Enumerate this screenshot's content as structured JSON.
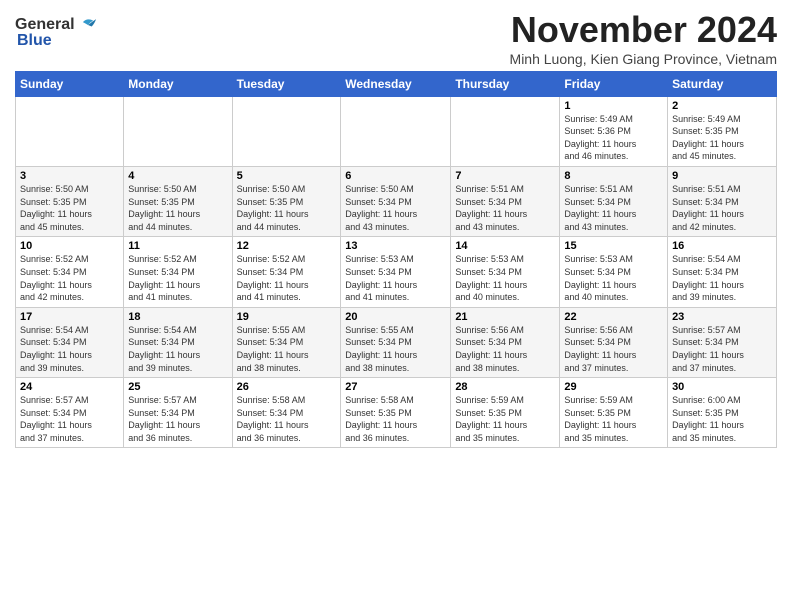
{
  "header": {
    "logo_general": "General",
    "logo_blue": "Blue",
    "month_title": "November 2024",
    "location": "Minh Luong, Kien Giang Province, Vietnam"
  },
  "weekdays": [
    "Sunday",
    "Monday",
    "Tuesday",
    "Wednesday",
    "Thursday",
    "Friday",
    "Saturday"
  ],
  "weeks": [
    [
      {
        "day": "",
        "info": ""
      },
      {
        "day": "",
        "info": ""
      },
      {
        "day": "",
        "info": ""
      },
      {
        "day": "",
        "info": ""
      },
      {
        "day": "",
        "info": ""
      },
      {
        "day": "1",
        "info": "Sunrise: 5:49 AM\nSunset: 5:36 PM\nDaylight: 11 hours\nand 46 minutes."
      },
      {
        "day": "2",
        "info": "Sunrise: 5:49 AM\nSunset: 5:35 PM\nDaylight: 11 hours\nand 45 minutes."
      }
    ],
    [
      {
        "day": "3",
        "info": "Sunrise: 5:50 AM\nSunset: 5:35 PM\nDaylight: 11 hours\nand 45 minutes."
      },
      {
        "day": "4",
        "info": "Sunrise: 5:50 AM\nSunset: 5:35 PM\nDaylight: 11 hours\nand 44 minutes."
      },
      {
        "day": "5",
        "info": "Sunrise: 5:50 AM\nSunset: 5:35 PM\nDaylight: 11 hours\nand 44 minutes."
      },
      {
        "day": "6",
        "info": "Sunrise: 5:50 AM\nSunset: 5:34 PM\nDaylight: 11 hours\nand 43 minutes."
      },
      {
        "day": "7",
        "info": "Sunrise: 5:51 AM\nSunset: 5:34 PM\nDaylight: 11 hours\nand 43 minutes."
      },
      {
        "day": "8",
        "info": "Sunrise: 5:51 AM\nSunset: 5:34 PM\nDaylight: 11 hours\nand 43 minutes."
      },
      {
        "day": "9",
        "info": "Sunrise: 5:51 AM\nSunset: 5:34 PM\nDaylight: 11 hours\nand 42 minutes."
      }
    ],
    [
      {
        "day": "10",
        "info": "Sunrise: 5:52 AM\nSunset: 5:34 PM\nDaylight: 11 hours\nand 42 minutes."
      },
      {
        "day": "11",
        "info": "Sunrise: 5:52 AM\nSunset: 5:34 PM\nDaylight: 11 hours\nand 41 minutes."
      },
      {
        "day": "12",
        "info": "Sunrise: 5:52 AM\nSunset: 5:34 PM\nDaylight: 11 hours\nand 41 minutes."
      },
      {
        "day": "13",
        "info": "Sunrise: 5:53 AM\nSunset: 5:34 PM\nDaylight: 11 hours\nand 41 minutes."
      },
      {
        "day": "14",
        "info": "Sunrise: 5:53 AM\nSunset: 5:34 PM\nDaylight: 11 hours\nand 40 minutes."
      },
      {
        "day": "15",
        "info": "Sunrise: 5:53 AM\nSunset: 5:34 PM\nDaylight: 11 hours\nand 40 minutes."
      },
      {
        "day": "16",
        "info": "Sunrise: 5:54 AM\nSunset: 5:34 PM\nDaylight: 11 hours\nand 39 minutes."
      }
    ],
    [
      {
        "day": "17",
        "info": "Sunrise: 5:54 AM\nSunset: 5:34 PM\nDaylight: 11 hours\nand 39 minutes."
      },
      {
        "day": "18",
        "info": "Sunrise: 5:54 AM\nSunset: 5:34 PM\nDaylight: 11 hours\nand 39 minutes."
      },
      {
        "day": "19",
        "info": "Sunrise: 5:55 AM\nSunset: 5:34 PM\nDaylight: 11 hours\nand 38 minutes."
      },
      {
        "day": "20",
        "info": "Sunrise: 5:55 AM\nSunset: 5:34 PM\nDaylight: 11 hours\nand 38 minutes."
      },
      {
        "day": "21",
        "info": "Sunrise: 5:56 AM\nSunset: 5:34 PM\nDaylight: 11 hours\nand 38 minutes."
      },
      {
        "day": "22",
        "info": "Sunrise: 5:56 AM\nSunset: 5:34 PM\nDaylight: 11 hours\nand 37 minutes."
      },
      {
        "day": "23",
        "info": "Sunrise: 5:57 AM\nSunset: 5:34 PM\nDaylight: 11 hours\nand 37 minutes."
      }
    ],
    [
      {
        "day": "24",
        "info": "Sunrise: 5:57 AM\nSunset: 5:34 PM\nDaylight: 11 hours\nand 37 minutes."
      },
      {
        "day": "25",
        "info": "Sunrise: 5:57 AM\nSunset: 5:34 PM\nDaylight: 11 hours\nand 36 minutes."
      },
      {
        "day": "26",
        "info": "Sunrise: 5:58 AM\nSunset: 5:34 PM\nDaylight: 11 hours\nand 36 minutes."
      },
      {
        "day": "27",
        "info": "Sunrise: 5:58 AM\nSunset: 5:35 PM\nDaylight: 11 hours\nand 36 minutes."
      },
      {
        "day": "28",
        "info": "Sunrise: 5:59 AM\nSunset: 5:35 PM\nDaylight: 11 hours\nand 35 minutes."
      },
      {
        "day": "29",
        "info": "Sunrise: 5:59 AM\nSunset: 5:35 PM\nDaylight: 11 hours\nand 35 minutes."
      },
      {
        "day": "30",
        "info": "Sunrise: 6:00 AM\nSunset: 5:35 PM\nDaylight: 11 hours\nand 35 minutes."
      }
    ]
  ]
}
